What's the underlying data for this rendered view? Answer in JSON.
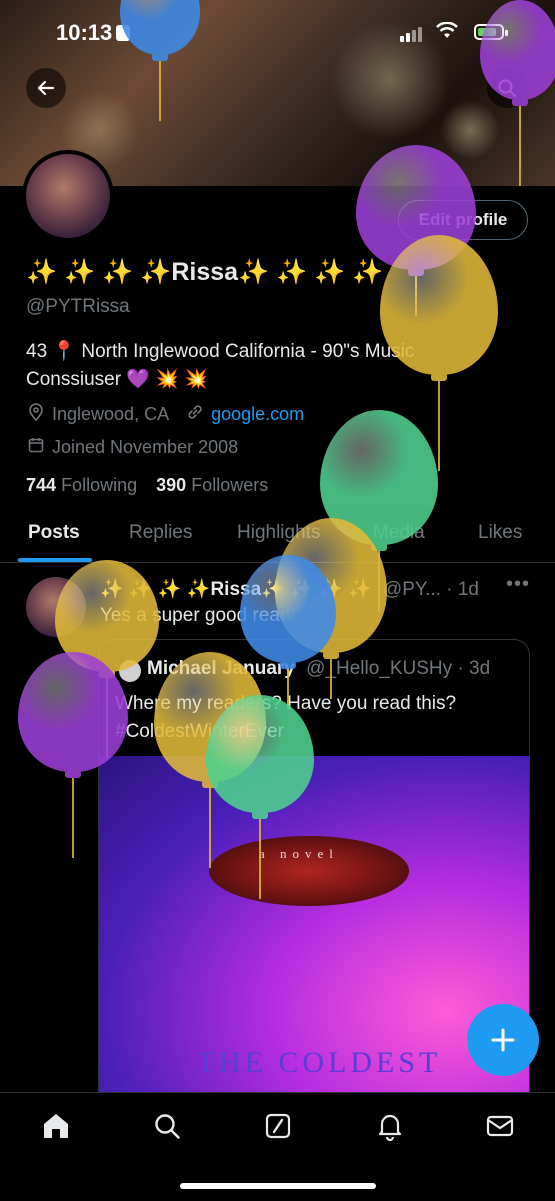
{
  "status_bar": {
    "time": "10:13"
  },
  "profile": {
    "display_name": "✨ ✨ ✨ ✨Rissa✨ ✨ ✨ ✨",
    "handle": "@PYTRissa",
    "edit_label": "Edit profile",
    "bio_line1": "43 📍 North Inglewood California - 90\"s Music",
    "bio_line2": "Conssiuser 💜 💥 💥",
    "location": "Inglewood, CA",
    "website": "google.com",
    "joined": "Joined November 2008",
    "following_count": "744",
    "following_label": "Following",
    "followers_count": "390",
    "followers_label": "Followers"
  },
  "tabs": [
    "Posts",
    "Replies",
    "Highlights",
    "Media",
    "Likes"
  ],
  "post": {
    "author": "✨ ✨ ✨ ✨Rissa✨ ✨ ✨ ✨",
    "handle_time": "@PY... · 1d",
    "text": "Yes a super good read!!",
    "quote": {
      "author": "Michael January",
      "handle_time": "@_Hello_KUSHy · 3d",
      "text": "Where my readers? Have you read this? #ColdestWinterEver",
      "book_tagline": "a novel",
      "book_title": "THE COLDEST"
    }
  },
  "icons": {
    "back": "back-arrow-icon",
    "search": "search-icon",
    "location": "location-pin-icon",
    "link": "link-icon",
    "calendar": "calendar-icon",
    "compose": "plus-icon",
    "nav": [
      "home-icon",
      "search-icon",
      "grok-icon",
      "notifications-icon",
      "messages-icon"
    ]
  },
  "colors": {
    "accent": "#1d9bf0",
    "balloon_purple": "#9b3fd6",
    "balloon_yellow": "#e0b93a",
    "balloon_green": "#4fd18f",
    "balloon_blue": "#3f8ae8"
  }
}
